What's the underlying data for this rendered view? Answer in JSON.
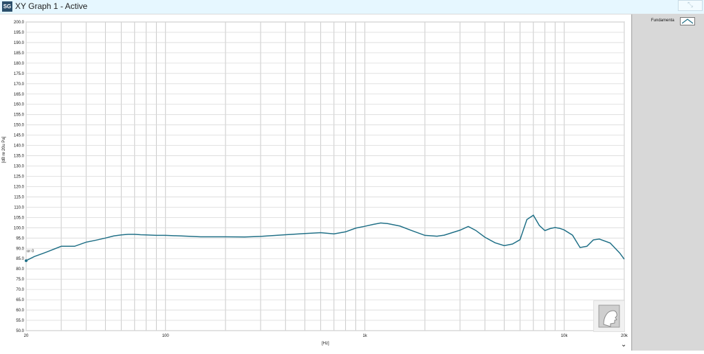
{
  "window": {
    "title": "XY Graph 1 - Active",
    "app_icon": "SG",
    "close_label": "⤡"
  },
  "legend": {
    "label": "Fundamenta"
  },
  "axes": {
    "xlabel": "[Hz]",
    "ylabel": "[dB re 20u Pa]",
    "xscale": "log"
  },
  "cursor": {
    "label": "or 0"
  },
  "chart_data": {
    "type": "line",
    "xlabel": "[Hz]",
    "ylabel": "[dB re 20u Pa]",
    "xlim": [
      20,
      20000
    ],
    "ylim": [
      50,
      200
    ],
    "y_ticks": [
      50,
      55,
      60,
      65,
      70,
      75,
      80,
      85,
      90,
      95,
      100,
      105,
      110,
      115,
      120,
      125,
      130,
      135,
      140,
      145,
      150,
      155,
      160,
      165,
      170,
      175,
      180,
      185,
      190,
      195,
      200
    ],
    "x_tick_labels": [
      {
        "value": 20,
        "label": "20"
      },
      {
        "value": 100,
        "label": "100"
      },
      {
        "value": 1000,
        "label": "1k"
      },
      {
        "value": 10000,
        "label": "10k"
      },
      {
        "value": 20000,
        "label": "20k"
      }
    ],
    "grid": true,
    "series": [
      {
        "name": "Fundamenta",
        "color": "#1f6f86",
        "x": [
          20,
          22,
          25,
          30,
          35,
          40,
          45,
          50,
          55,
          60,
          65,
          70,
          75,
          80,
          90,
          100,
          120,
          150,
          200,
          250,
          300,
          400,
          500,
          600,
          700,
          800,
          900,
          1000,
          1100,
          1200,
          1300,
          1500,
          1700,
          2000,
          2300,
          2500,
          3000,
          3300,
          3600,
          4000,
          4500,
          5000,
          5500,
          6000,
          6500,
          7000,
          7500,
          8000,
          8500,
          9000,
          9500,
          10000,
          11000,
          12000,
          13000,
          14000,
          15000,
          17000,
          19000,
          20000
        ],
        "y": [
          84,
          86,
          88,
          91,
          91,
          93,
          94,
          95,
          96,
          96.5,
          96.8,
          96.8,
          96.6,
          96.5,
          96.3,
          96.3,
          96,
          95.6,
          95.6,
          95.5,
          95.8,
          96.6,
          97.2,
          97.6,
          97,
          98,
          99.8,
          100.7,
          101.6,
          102.3,
          102,
          100.8,
          98.8,
          96.3,
          95.9,
          96.4,
          98.8,
          100.6,
          98.7,
          95.4,
          92.7,
          91.3,
          92.1,
          94.2,
          104,
          106.1,
          101.1,
          98.6,
          99.6,
          100.1,
          99.7,
          98.9,
          96.4,
          90.4,
          91,
          94.1,
          94.5,
          92.6,
          87.7,
          84.7
        ]
      }
    ]
  }
}
